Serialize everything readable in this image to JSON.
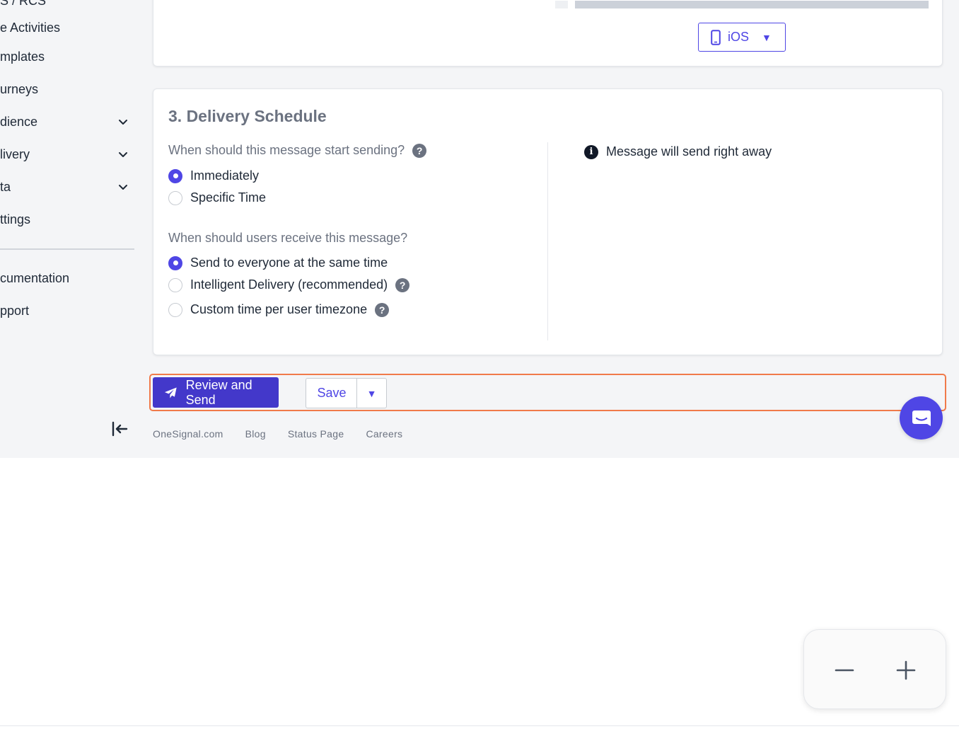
{
  "sidebar": {
    "items": [
      {
        "label": "S / RCS",
        "expandable": false
      },
      {
        "label": "e Activities",
        "expandable": false
      },
      {
        "label": "mplates",
        "expandable": false
      },
      {
        "label": "urneys",
        "expandable": false
      },
      {
        "label": "dience",
        "expandable": true
      },
      {
        "label": "livery",
        "expandable": true
      },
      {
        "label": "ta",
        "expandable": true
      },
      {
        "label": "ttings",
        "expandable": false
      }
    ],
    "secondary_items": [
      {
        "label": "cumentation"
      },
      {
        "label": "pport"
      }
    ]
  },
  "preview": {
    "platform_label": "iOS"
  },
  "delivery_schedule": {
    "title": "3. Delivery Schedule",
    "start_question": "When should this message start sending?",
    "start_options": [
      {
        "label": "Immediately",
        "selected": true
      },
      {
        "label": "Specific Time",
        "selected": false
      }
    ],
    "receive_question": "When should users receive this message?",
    "receive_options": [
      {
        "label": "Send to everyone at the same time",
        "selected": true,
        "help": false
      },
      {
        "label": "Intelligent Delivery (recommended)",
        "selected": false,
        "help": true
      },
      {
        "label": "Custom time per user timezone",
        "selected": false,
        "help": true
      }
    ],
    "info_text": "Message will send right away"
  },
  "actions": {
    "review_label": "Review and Send",
    "save_label": "Save",
    "caret": "▼"
  },
  "footer": {
    "links": [
      "OneSignal.com",
      "Blog",
      "Status Page",
      "Careers"
    ]
  },
  "colors": {
    "accent": "#4f46e5",
    "primary_button": "#4338ca",
    "highlight_border": "#f07a4a"
  },
  "help_glyph": "?",
  "info_glyph": "i"
}
